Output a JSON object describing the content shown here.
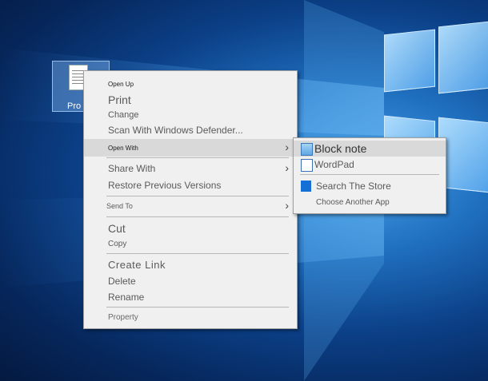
{
  "desktop": {
    "icon_label": "Pro"
  },
  "context_menu": {
    "items": [
      {
        "label": "Open Up",
        "size": 8
      },
      {
        "label": "Print",
        "size": 14
      },
      {
        "label": "Change",
        "size": 11
      },
      {
        "label": "Scan With Windows Defender...",
        "size": 12
      },
      {
        "label": "Open With",
        "size": 8,
        "submenu": true
      },
      {
        "label": "Share With",
        "size": 12,
        "submenu": true
      },
      {
        "label": "Restore Previous Versions",
        "size": 12
      },
      {
        "label": "Send To",
        "size": 9,
        "submenu": true
      },
      {
        "label": "Cut",
        "size": 14
      },
      {
        "label": "Copy",
        "size": 10
      },
      {
        "label": "Create Link",
        "size": 13
      },
      {
        "label": "Delete",
        "size": 12
      },
      {
        "label": "Rename",
        "size": 12
      },
      {
        "label": "Property",
        "size": 10
      }
    ]
  },
  "open_with_submenu": {
    "items": [
      {
        "label": "Block note",
        "icon": "notepad-icon"
      },
      {
        "label": "WordPad",
        "icon": "wordpad-icon"
      },
      {
        "label": "Search The Store",
        "icon": "store-icon"
      },
      {
        "label": "Choose Another App",
        "icon": ""
      }
    ]
  },
  "colors": {
    "menu_bg": "#f0f0f0",
    "highlight": "#d9d9d9",
    "desktop_blue": "#0b3f86"
  }
}
